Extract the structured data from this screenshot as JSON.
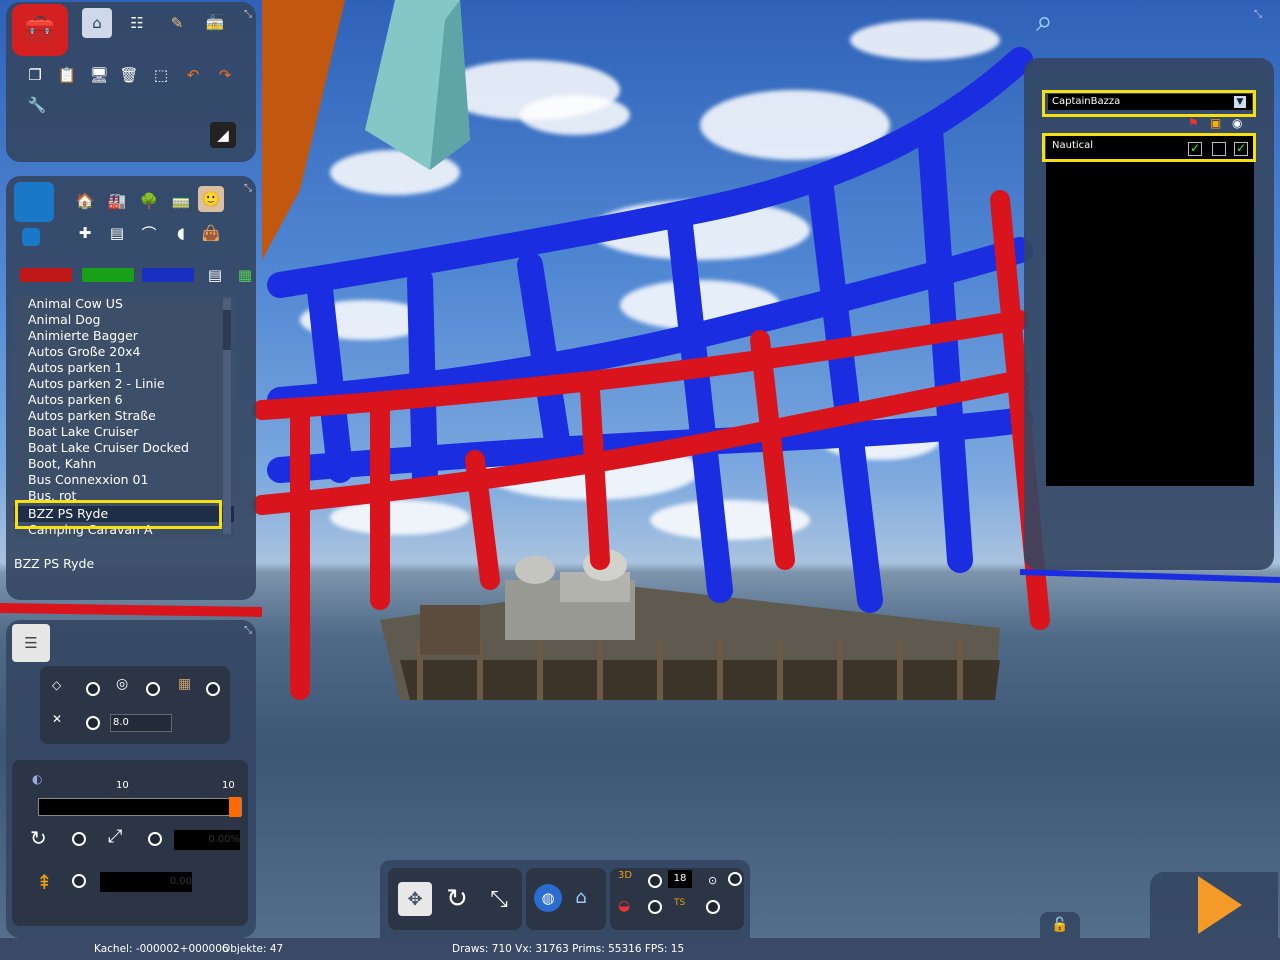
{
  "asset_list": {
    "items": [
      "Animal Cow US",
      "Animal Dog",
      "Animierte Bagger",
      "Autos Große 20x4",
      "Autos parken 1",
      "Autos parken 2 - Linie",
      "Autos parken 6",
      "Autos parken Straße",
      "Boat Lake Cruiser",
      "Boat Lake Cruiser Docked",
      "Boot, Kahn",
      "Bus Connexxion 01",
      "Bus, rot",
      "BZZ PS Ryde",
      "Camping Caravan A"
    ],
    "selected_index": 13,
    "selected_name": "BZZ PS Ryde"
  },
  "properties": {
    "height_value": "8.0",
    "slider_left_label": "10",
    "slider_right_label": "10",
    "slider_fraction": 1.0,
    "rotation_value": "0.00%",
    "height_offset_value": "0.00"
  },
  "camera_toolbar": {
    "grid_value": "18"
  },
  "layers": {
    "owner": "CaptainBazza",
    "layer_name": "Nautical",
    "checkboxes": [
      true,
      false,
      true
    ]
  },
  "status": {
    "tile": "Kachel: -000002+000006",
    "objects": "Objekte: 47",
    "stats": "Draws: 710 Vx: 31763 Prims: 55316 FPS: 15"
  },
  "icons": {
    "toolbox": "toolbox-icon",
    "home": "home-icon",
    "track": "track-icon",
    "brush": "brush-icon",
    "train": "train-icon",
    "search": "magnifier-icon",
    "play": "play-icon",
    "lock": "lock-icon"
  },
  "colors": {
    "highlight": "#f6e012",
    "panel": "#344662",
    "red_frame": "#e0141a",
    "blue_frame": "#1428e6"
  }
}
